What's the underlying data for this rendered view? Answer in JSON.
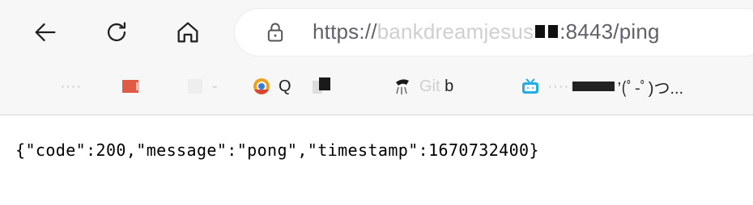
{
  "browser": {
    "url_visible_start": "https://",
    "url_visible_end": ":8443/ping",
    "buttons": {
      "back": "back",
      "reload": "reload",
      "home": "home"
    }
  },
  "bookmarks": [
    {
      "label": "",
      "favicon": "blurred"
    },
    {
      "label": "",
      "favicon": "red-folder"
    },
    {
      "label": "",
      "favicon": "gray-square"
    },
    {
      "label": "Q",
      "favicon": "orange-blue-circle"
    },
    {
      "label": "",
      "favicon": "dark-square"
    },
    {
      "label": "b",
      "favicon": "github-cat"
    },
    {
      "label": "’(ﾟ-ﾟ)つ...",
      "favicon": "blue-tv"
    }
  ],
  "response": {
    "text": "{\"code\":200,\"message\":\"pong\",\"timestamp\":1670732400}"
  },
  "colors": {
    "chrome_bg": "#f7f7f7",
    "omnibox_bg": "#ffffff",
    "url_text": "#5f6368"
  }
}
